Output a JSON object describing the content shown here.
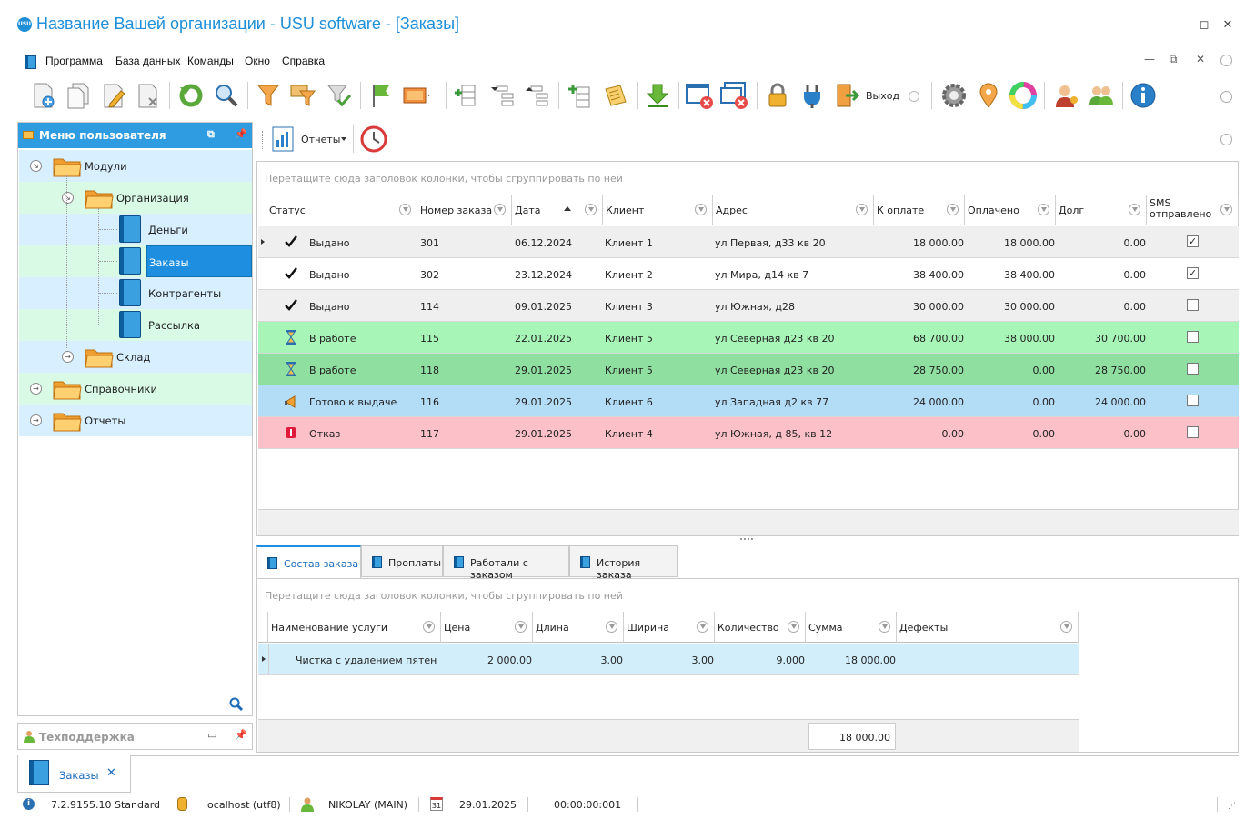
{
  "window": {
    "title": "Название Вашей организации - USU software - [Заказы]",
    "logo_text": "USU"
  },
  "menu": [
    "Программа",
    "База данных",
    "Команды",
    "Окно",
    "Справка"
  ],
  "toolbar": {
    "exit_label": "Выход"
  },
  "sub_toolbar": {
    "reports_label": "Отчеты"
  },
  "sidebar": {
    "header": "Меню пользователя",
    "items": [
      {
        "label": "Модули",
        "level": 0,
        "type": "folder",
        "expanded": true
      },
      {
        "label": "Организация",
        "level": 1,
        "type": "folder",
        "expanded": true
      },
      {
        "label": "Деньги",
        "level": 2,
        "type": "book"
      },
      {
        "label": "Заказы",
        "level": 2,
        "type": "book",
        "selected": true
      },
      {
        "label": "Контрагенты",
        "level": 2,
        "type": "book"
      },
      {
        "label": "Рассылка",
        "level": 2,
        "type": "book"
      },
      {
        "label": "Склад",
        "level": 1,
        "type": "folder",
        "expanded": false
      },
      {
        "label": "Справочники",
        "level": 0,
        "type": "folder",
        "expanded": false
      },
      {
        "label": "Отчеты",
        "level": 0,
        "type": "folder",
        "expanded": false
      }
    ],
    "support_label": "Техподдержка"
  },
  "grid": {
    "group_hint": "Перетащите сюда заголовок колонки, чтобы сгруппировать по ней",
    "columns": [
      "Статус",
      "Номер заказа",
      "Дата",
      "Клиент",
      "Адрес",
      "К оплате",
      "Оплачено",
      "Долг",
      "SMS отправлено"
    ],
    "rows": [
      {
        "status": "Выдано",
        "icon": "check",
        "num": "301",
        "date": "06.12.2024",
        "client": "Клиент 1",
        "address": "ул Первая, д33 кв 20",
        "to_pay": "18 000.00",
        "paid": "18 000.00",
        "debt": "0.00",
        "sms": true,
        "bg": "#efefef"
      },
      {
        "status": "Выдано",
        "icon": "check",
        "num": "302",
        "date": "23.12.2024",
        "client": "Клиент 2",
        "address": "ул Мира, д14 кв 7",
        "to_pay": "38 400.00",
        "paid": "38 400.00",
        "debt": "0.00",
        "sms": true,
        "bg": "#ffffff"
      },
      {
        "status": "Выдано",
        "icon": "check",
        "num": "114",
        "date": "09.01.2025",
        "client": "Клиент 3",
        "address": "ул Южная, д28",
        "to_pay": "30 000.00",
        "paid": "30 000.00",
        "debt": "0.00",
        "sms": false,
        "bg": "#efefef"
      },
      {
        "status": "В работе",
        "icon": "hourglass",
        "num": "115",
        "date": "22.01.2025",
        "client": "Клиент 5",
        "address": "ул Северная д23 кв 20",
        "to_pay": "68 700.00",
        "paid": "38 000.00",
        "debt": "30 700.00",
        "sms": false,
        "bg": "#a8f5b8"
      },
      {
        "status": "В работе",
        "icon": "hourglass",
        "num": "118",
        "date": "29.01.2025",
        "client": "Клиент 5",
        "address": "ул Северная д23 кв 20",
        "to_pay": "28 750.00",
        "paid": "0.00",
        "debt": "28 750.00",
        "sms": false,
        "bg": "#8fe0a0"
      },
      {
        "status": "Готово к выдаче",
        "icon": "horn",
        "num": "116",
        "date": "29.01.2025",
        "client": "Клиент 6",
        "address": "ул Западная д2 кв 77",
        "to_pay": "24 000.00",
        "paid": "0.00",
        "debt": "24 000.00",
        "sms": false,
        "bg": "#b3dcf7"
      },
      {
        "status": "Отказ",
        "icon": "alert",
        "num": "117",
        "date": "29.01.2025",
        "client": "Клиент 4",
        "address": "ул Южная, д 85, кв 12",
        "to_pay": "0.00",
        "paid": "0.00",
        "debt": "0.00",
        "sms": false,
        "bg": "#fbc0c8"
      }
    ]
  },
  "tabs": [
    "Состав заказа",
    "Проплаты",
    "Работали с заказом",
    "История заказа"
  ],
  "detail": {
    "group_hint": "Перетащите сюда заголовок колонки, чтобы сгруппировать по ней",
    "columns": [
      "Наименование услуги",
      "Цена",
      "Длина",
      "Ширина",
      "Количество",
      "Сумма",
      "Дефекты"
    ],
    "rows": [
      {
        "name": "Чистка с удалением пятен",
        "price": "2 000.00",
        "length": "3.00",
        "width": "3.00",
        "qty": "9.000",
        "sum": "18 000.00",
        "defects": ""
      }
    ],
    "total": "18 000.00"
  },
  "bottom_tab": "Заказы",
  "status": {
    "version": "7.2.9155.10 Standard",
    "db": "localhost (utf8)",
    "user": "NIKOLAY (MAIN)",
    "cal_day": "31",
    "date": "29.01.2025",
    "timer": "00:00:00:001"
  }
}
